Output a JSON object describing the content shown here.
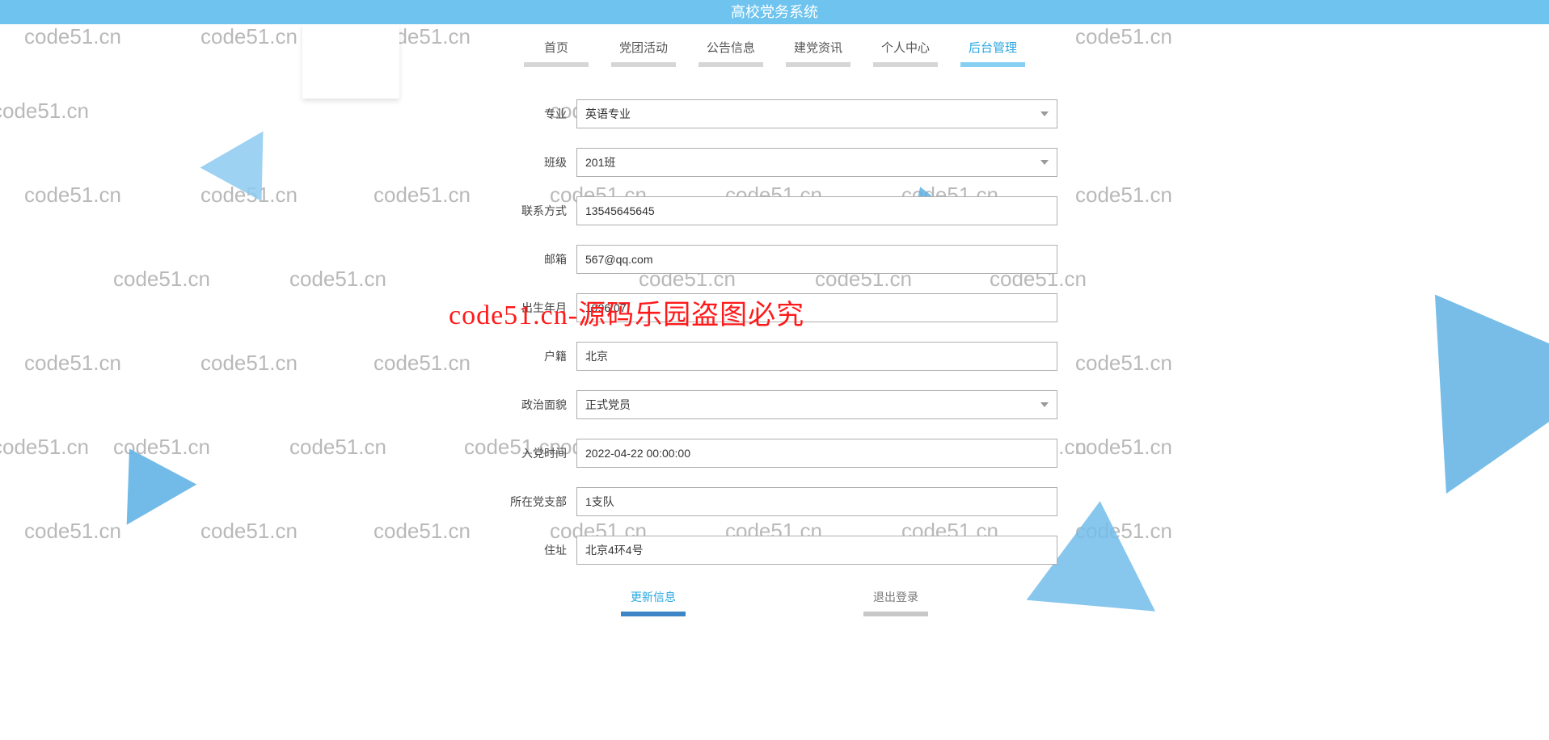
{
  "header": {
    "title": "高校党务系统"
  },
  "nav": {
    "items": [
      {
        "label": "首页"
      },
      {
        "label": "党团活动"
      },
      {
        "label": "公告信息"
      },
      {
        "label": "建党资讯"
      },
      {
        "label": "个人中心"
      },
      {
        "label": "后台管理"
      }
    ],
    "active_index": 5
  },
  "form": {
    "fields": {
      "major": {
        "label": "专业",
        "value": "英语专业",
        "type": "select"
      },
      "class": {
        "label": "班级",
        "value": "201班",
        "type": "select"
      },
      "phone": {
        "label": "联系方式",
        "value": "13545645645",
        "type": "text"
      },
      "email": {
        "label": "邮箱",
        "value": "567@qq.com",
        "type": "text"
      },
      "birth": {
        "label": "出生年月",
        "value": "1996.07",
        "type": "text"
      },
      "hukou": {
        "label": "户籍",
        "value": "北京",
        "type": "text"
      },
      "political": {
        "label": "政治面貌",
        "value": "正式党员",
        "type": "select"
      },
      "join_date": {
        "label": "入党时间",
        "value": "2022-04-22 00:00:00",
        "type": "text"
      },
      "branch": {
        "label": "所在党支部",
        "value": "1支队",
        "type": "text"
      },
      "address": {
        "label": "住址",
        "value": "北京4环4号",
        "type": "text"
      }
    }
  },
  "actions": {
    "update": "更新信息",
    "logout": "退出登录"
  },
  "watermark": {
    "text": "code51.cn",
    "red_overlay": "code51.cn-源码乐园盗图必究"
  }
}
